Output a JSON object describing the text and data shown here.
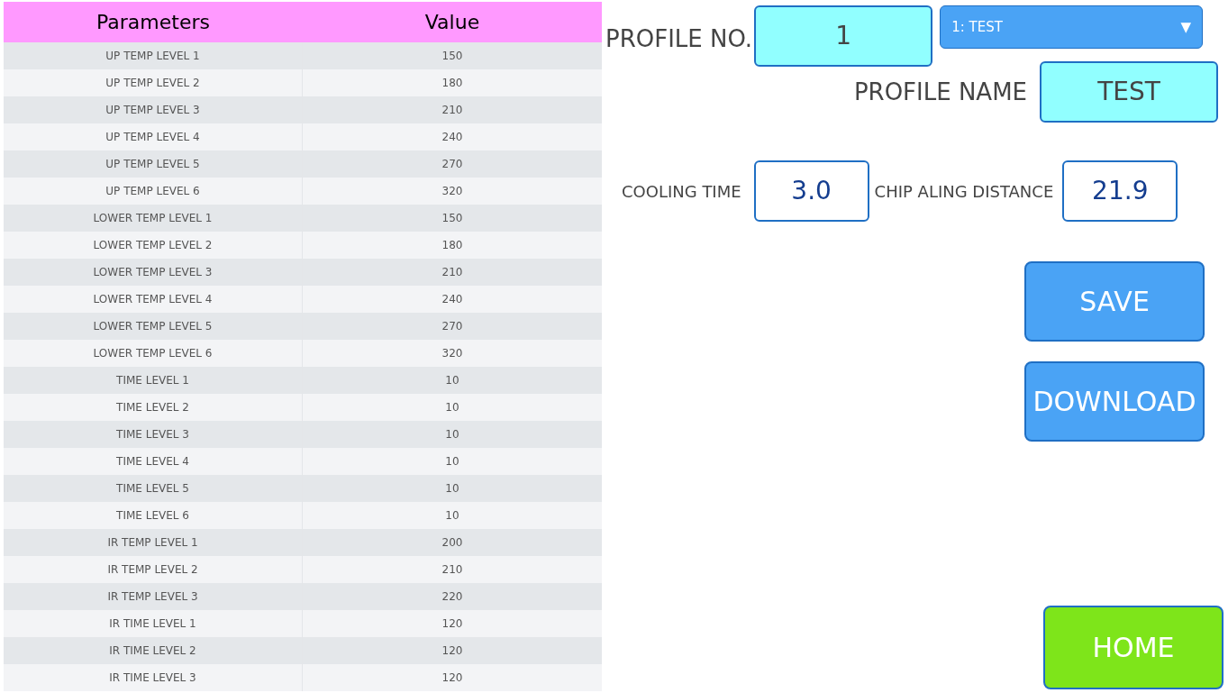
{
  "table": {
    "columns": [
      "Parameters",
      "Value"
    ],
    "rows": [
      {
        "parameter": "UP TEMP LEVEL 1",
        "value": "150"
      },
      {
        "parameter": "UP TEMP LEVEL 2",
        "value": "180"
      },
      {
        "parameter": "UP TEMP LEVEL 3",
        "value": "210"
      },
      {
        "parameter": "UP TEMP LEVEL 4",
        "value": "240"
      },
      {
        "parameter": "UP TEMP LEVEL 5",
        "value": "270"
      },
      {
        "parameter": "UP TEMP LEVEL 6",
        "value": "320"
      },
      {
        "parameter": "LOWER TEMP LEVEL 1",
        "value": "150"
      },
      {
        "parameter": "LOWER TEMP LEVEL 2",
        "value": "180"
      },
      {
        "parameter": "LOWER TEMP LEVEL 3",
        "value": "210"
      },
      {
        "parameter": "LOWER TEMP LEVEL 4",
        "value": "240"
      },
      {
        "parameter": "LOWER TEMP LEVEL 5",
        "value": "270"
      },
      {
        "parameter": "LOWER TEMP LEVEL 6",
        "value": "320"
      },
      {
        "parameter": "TIME LEVEL 1",
        "value": "10"
      },
      {
        "parameter": "TIME LEVEL 2",
        "value": "10"
      },
      {
        "parameter": "TIME LEVEL 3",
        "value": "10"
      },
      {
        "parameter": "TIME LEVEL 4",
        "value": "10"
      },
      {
        "parameter": "TIME LEVEL 5",
        "value": "10"
      },
      {
        "parameter": "TIME LEVEL 6",
        "value": "10"
      },
      {
        "parameter": "IR TEMP LEVEL 1",
        "value": "200"
      },
      {
        "parameter": "IR TEMP LEVEL 2",
        "value": "210"
      },
      {
        "parameter": "IR TEMP LEVEL 3",
        "value": "220"
      },
      {
        "parameter": "IR TIME LEVEL 1",
        "value": "120"
      },
      {
        "parameter": "IR TIME LEVEL 2",
        "value": "120"
      },
      {
        "parameter": "IR TIME LEVEL 3",
        "value": "120"
      }
    ]
  },
  "profile_no": {
    "label": "PROFILE NO.",
    "value": "1"
  },
  "profile_select": {
    "value": "1: TEST",
    "arrow": "▼"
  },
  "profile_name": {
    "label": "PROFILE NAME",
    "value": "TEST"
  },
  "cooling_time": {
    "label": "COOLING TIME",
    "value": "3.0"
  },
  "chip_align_distance": {
    "label": "CHIP ALING DISTANCE",
    "value": "21.9"
  },
  "buttons": [
    {
      "label": "SAVE",
      "kind": "primary"
    },
    {
      "label": "DOWNLOAD",
      "kind": "primary"
    }
  ],
  "home_button": {
    "label": "HOME"
  }
}
